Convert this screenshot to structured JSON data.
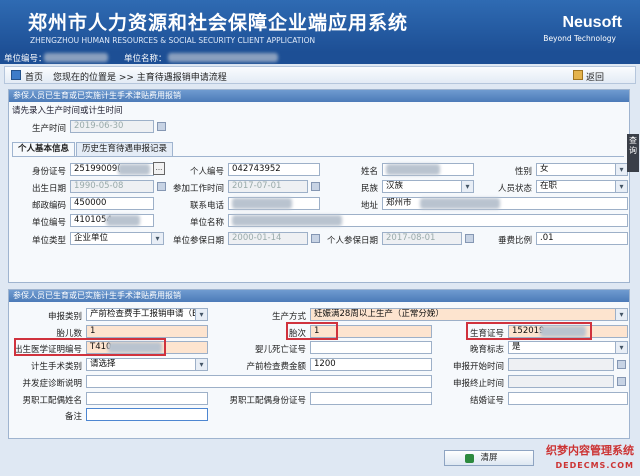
{
  "header": {
    "title": "郑州市人力资源和社会保障企业端应用系统",
    "subtitle": "ZHENGZHOU HUMAN RESOURCES & SOCIAL SECURITY CLIENT APPLICATION",
    "logo": "Neusoft",
    "slogan": "Beyond Technology"
  },
  "account": {
    "unit_no_label": "单位编号：",
    "unit_name_label": "单位名称："
  },
  "nav": {
    "home": "首页",
    "location": "您现在的位置是 >> 主育待遇报销申请流程",
    "back": "返回"
  },
  "panel1": {
    "title": "参保人员已生育或已实施计生手术津贴费用报销",
    "hint": "请先录入生产时间或计生时间",
    "birth_time_label": "生产时间",
    "birth_time_value": "2019-06-30"
  },
  "tabs": [
    "个人基本信息",
    "历史生育待遇申报记录"
  ],
  "basic": {
    "id_label": "身份证号",
    "id_value": "25199009(",
    "id_btn": "...",
    "pno_label": "个人编号",
    "pno_value": "042743952",
    "name_label": "姓名",
    "gender_label": "性别",
    "gender_value": "女",
    "dob_label": "出生日期",
    "dob_value": "1990-05-08",
    "work_label": "参加工作时间",
    "work_value": "2017-07-01",
    "nation_label": "民族",
    "nation_value": "汉族",
    "status_label": "人员状态",
    "status_value": "在职",
    "zip_label": "邮政编码",
    "zip_value": "450000",
    "phone_label": "联系电话",
    "addr_label": "地址",
    "addr_value": "郑州市",
    "uno_label": "单位编号",
    "uno_value": "4101054",
    "uname_label": "单位名称",
    "utype_label": "单位类型",
    "utype_value": "企业单位",
    "uins_label": "单位参保日期",
    "uins_value": "2000-01-14",
    "pins_label": "个人参保日期",
    "pins_value": "2017-08-01",
    "ratio_label": "垂费比例",
    "ratio_value": ".01"
  },
  "panel2": {
    "title": "参保人员已生育或已实施计生手术津贴费用报销",
    "apply_label": "申报类别",
    "apply_value": "产前检查费手工报销申请（B",
    "mode_label": "生产方式",
    "mode_value": "妊娠满28周以上生产（正常分娩）",
    "fetus_label": "胎儿数",
    "fetus_value": "1",
    "parity_label": "胎次",
    "parity_value": "1",
    "cert_label": "生育证号",
    "cert_value": "152019",
    "birthcert_label": "出生医学证明编号",
    "birthcert_value": "T410",
    "late_label": "晚育标志",
    "late_value": "是",
    "fp_label": "计生手术类别",
    "fp_value": "请选择",
    "death_label": "婴儿死亡证号",
    "fee_label": "产前检查费金额",
    "fee_value": "1200",
    "start_label": "申报开始时间",
    "comp_label": "并发症诊断说明",
    "end_label": "申报终止时间",
    "spouse_label": "男职工配偶姓名",
    "spouse_id_label": "男职工配偶身份证号",
    "marriage_label": "结婚证号",
    "remark_label": "备注"
  },
  "side_tab": "查询",
  "clear_button": "清屏",
  "watermark": {
    "line1": "织梦内容管理系统",
    "line2": "DEDECMS.COM"
  }
}
